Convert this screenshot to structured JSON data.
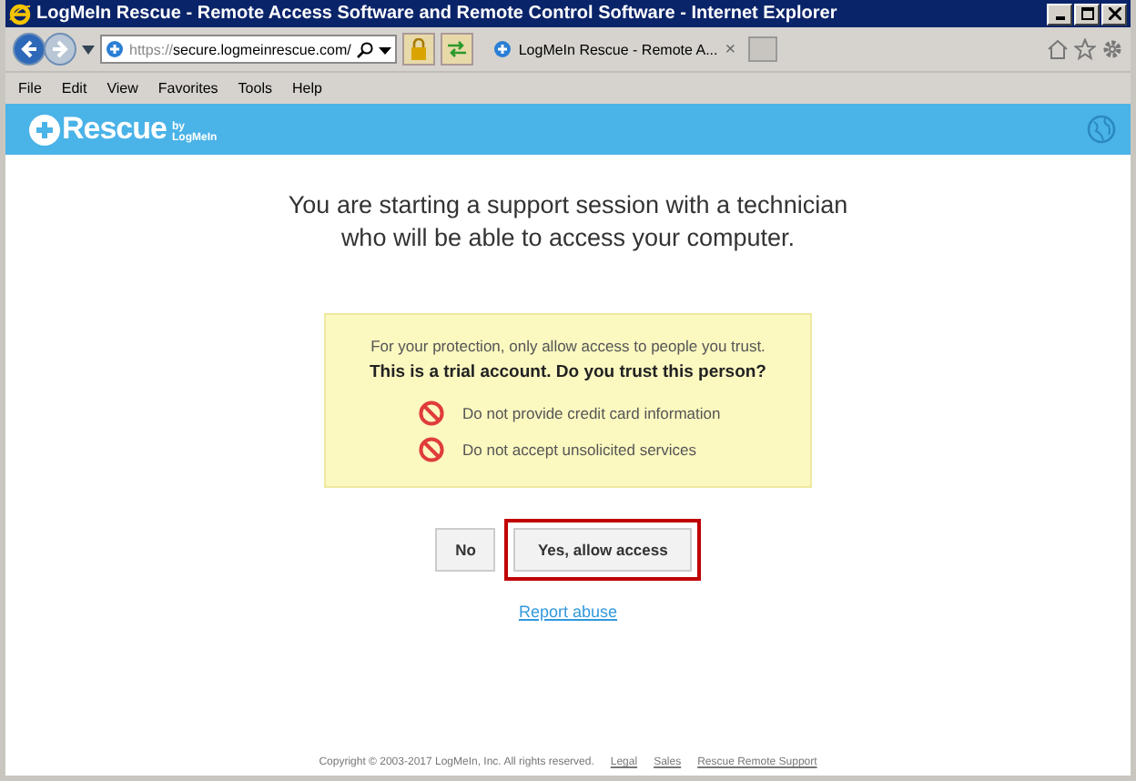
{
  "window": {
    "title": "LogMeIn Rescue - Remote Access Software and Remote Control Software - Internet Explorer"
  },
  "address_bar": {
    "scheme": "https://",
    "domain": "secure.logmeinrescue.com/"
  },
  "tab": {
    "title": "LogMeIn Rescue - Remote A...",
    "close": "×"
  },
  "menu": [
    "File",
    "Edit",
    "View",
    "Favorites",
    "Tools",
    "Help"
  ],
  "header": {
    "logo": "Rescue",
    "by": "by",
    "brand": "LogMeIn"
  },
  "heading": [
    "You are starting a support session with a technician",
    "who will be able to access your computer."
  ],
  "notice": {
    "intro": "For your protection, only allow access to people you trust.",
    "question": "This is a trial account. Do you trust this person?",
    "warnings": [
      "Do not provide credit card information",
      "Do not accept unsolicited services"
    ]
  },
  "buttons": [
    {
      "label": "No",
      "highlighted": false
    },
    {
      "label": "Yes, allow access",
      "highlighted": true
    }
  ],
  "report_link": "Report abuse",
  "footer": {
    "copyright": "Copyright © 2003-2017 LogMeIn, Inc. All rights reserved.",
    "links": [
      "Legal",
      "Sales",
      "Rescue Remote Support"
    ]
  }
}
